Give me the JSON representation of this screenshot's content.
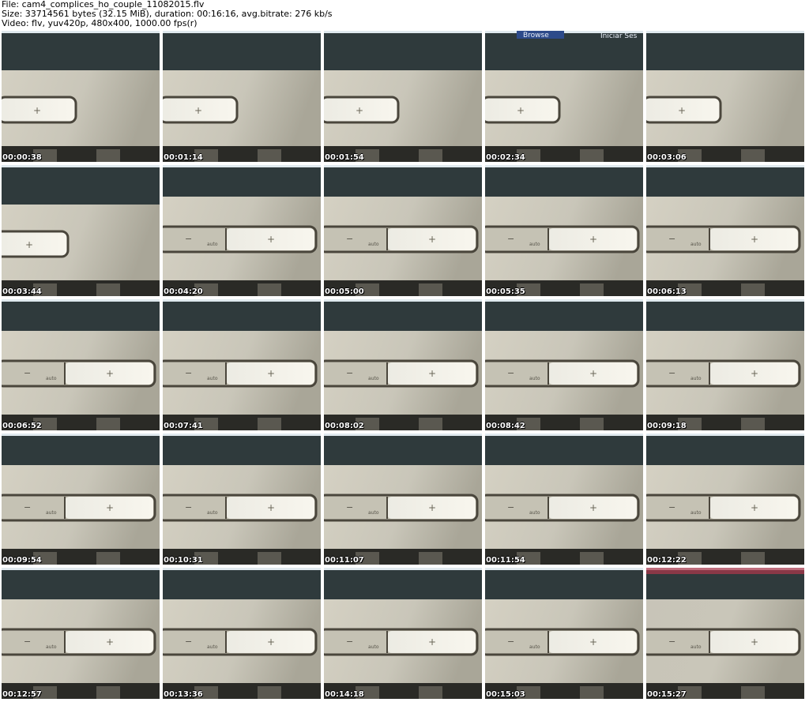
{
  "header": {
    "file_line": "File: cam4_complices_ho_couple_11082015.flv",
    "size_line": "Size: 33714561 bytes (32.15 MiB), duration: 00:16:16, avg.bitrate: 276 kb/s",
    "video_line": "Video: flv, yuv420p, 480x400, 1000.00 fps(r)"
  },
  "thumb_labels": {
    "browse": "Browse",
    "iniciar": "Iniciar Ses",
    "minus": "−",
    "plus": "+",
    "auto": "auto"
  },
  "thumbnails": [
    {
      "time": "00:00:38",
      "variant": "single"
    },
    {
      "time": "00:01:14",
      "variant": "single"
    },
    {
      "time": "00:01:54",
      "variant": "single"
    },
    {
      "time": "00:02:34",
      "variant": "single",
      "overlay": true
    },
    {
      "time": "00:03:06",
      "variant": "single"
    },
    {
      "time": "00:03:44",
      "variant": "single-left"
    },
    {
      "time": "00:04:20",
      "variant": "double"
    },
    {
      "time": "00:05:00",
      "variant": "double"
    },
    {
      "time": "00:05:35",
      "variant": "double"
    },
    {
      "time": "00:06:13",
      "variant": "double"
    },
    {
      "time": "00:06:52",
      "variant": "double"
    },
    {
      "time": "00:07:41",
      "variant": "double"
    },
    {
      "time": "00:08:02",
      "variant": "double"
    },
    {
      "time": "00:08:42",
      "variant": "double"
    },
    {
      "time": "00:09:18",
      "variant": "double"
    },
    {
      "time": "00:09:54",
      "variant": "double"
    },
    {
      "time": "00:10:31",
      "variant": "double"
    },
    {
      "time": "00:11:07",
      "variant": "double"
    },
    {
      "time": "00:11:54",
      "variant": "double"
    },
    {
      "time": "00:12:22",
      "variant": "double"
    },
    {
      "time": "00:12:57",
      "variant": "double"
    },
    {
      "time": "00:13:36",
      "variant": "double"
    },
    {
      "time": "00:14:18",
      "variant": "double"
    },
    {
      "time": "00:15:03",
      "variant": "double"
    },
    {
      "time": "00:15:27",
      "variant": "double",
      "tint": true
    }
  ]
}
